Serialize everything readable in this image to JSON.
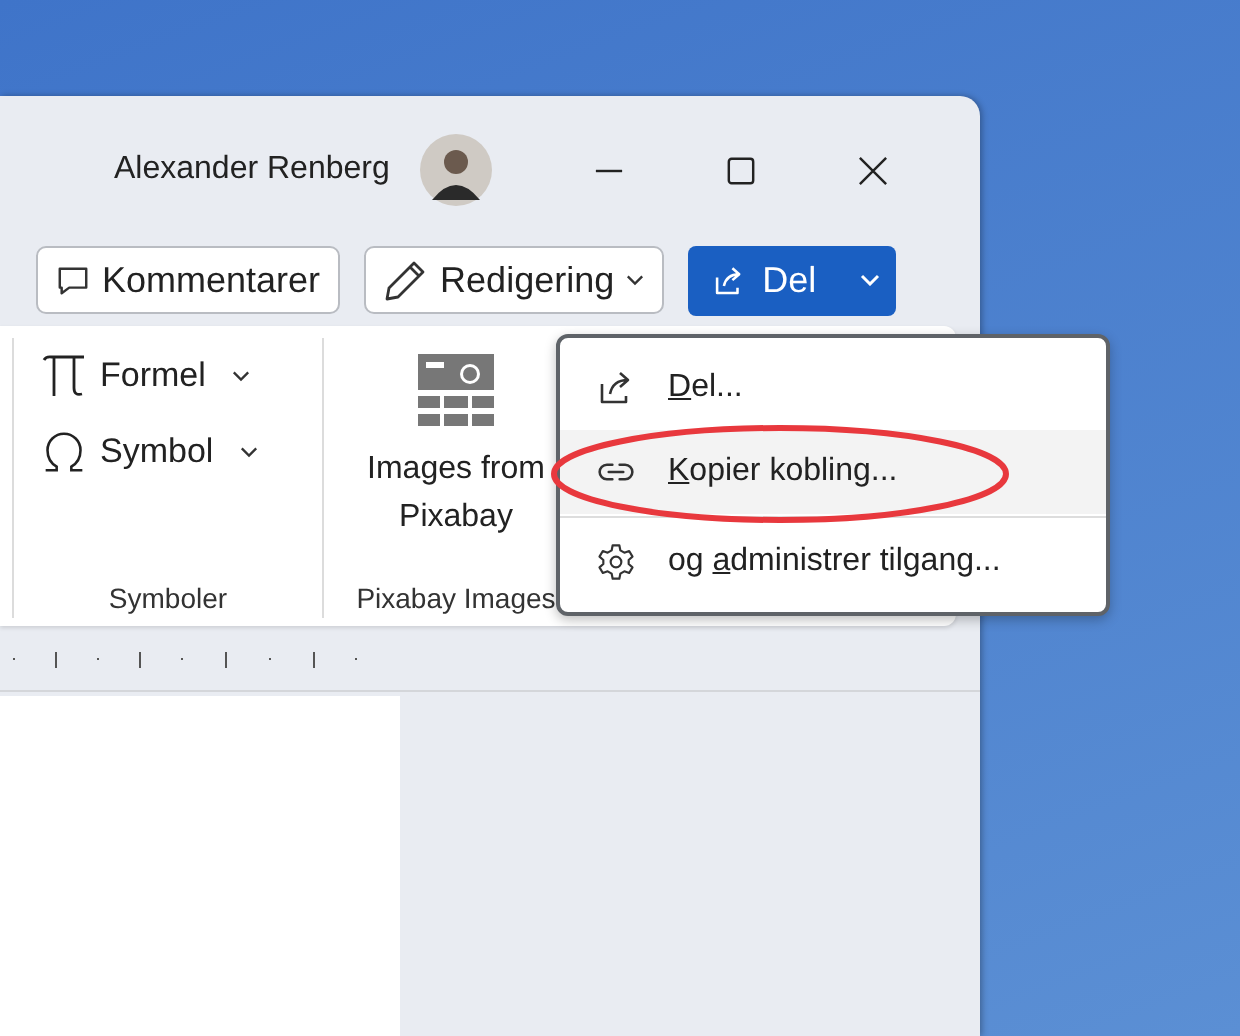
{
  "title_bar": {
    "user_name": "Alexander Renberg"
  },
  "actions": [
    {
      "kind": "comment",
      "label": "Kommentarer"
    },
    {
      "kind": "editing",
      "label": "Redigering"
    },
    {
      "kind": "share",
      "label": "Del"
    }
  ],
  "ribbon": {
    "groups": [
      {
        "label": "Symboler",
        "items": [
          {
            "kind": "formula",
            "label": "Formel"
          },
          {
            "kind": "symbol",
            "label": "Symbol"
          }
        ]
      },
      {
        "label": "Pixabay Images",
        "items": [
          {
            "kind": "pixabay",
            "label": "Images from Pixabay"
          }
        ]
      }
    ]
  },
  "share_menu": {
    "items": [
      {
        "kind": "share",
        "key": "D",
        "post": "el...",
        "selected": false,
        "circled": false
      },
      {
        "kind": "link",
        "key": "K",
        "post": "opier kobling...",
        "selected": true,
        "circled": true
      },
      {
        "kind": "gear",
        "pre": "og ",
        "key": "a",
        "post": "dministrer tilgang...",
        "selected": false,
        "circled": false
      }
    ]
  }
}
